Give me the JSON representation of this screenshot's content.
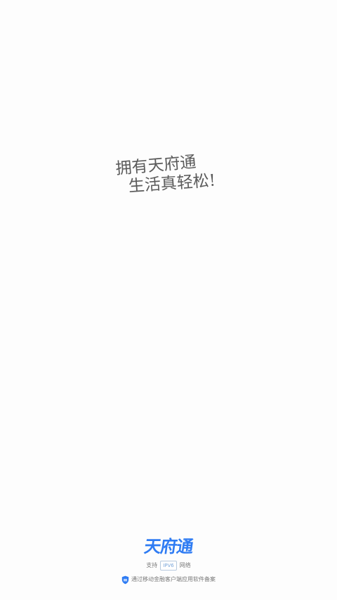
{
  "splash": {
    "slogan_line_1": "拥有天府通",
    "slogan_line_2": "生活真轻松!",
    "brand_name": "天府通",
    "support_prefix": "支持",
    "support_badge": "IPV6",
    "support_suffix": "网络",
    "filing_text": "通过移动金融客户端应用软件备案"
  },
  "colors": {
    "background": "#fdfdfd",
    "brand_blue": "#2f7cf3",
    "text_gray": "#7a7a7a",
    "handwriting_gray": "#5b5b5b"
  },
  "icons": {
    "filing_icon": "shield-icon"
  }
}
